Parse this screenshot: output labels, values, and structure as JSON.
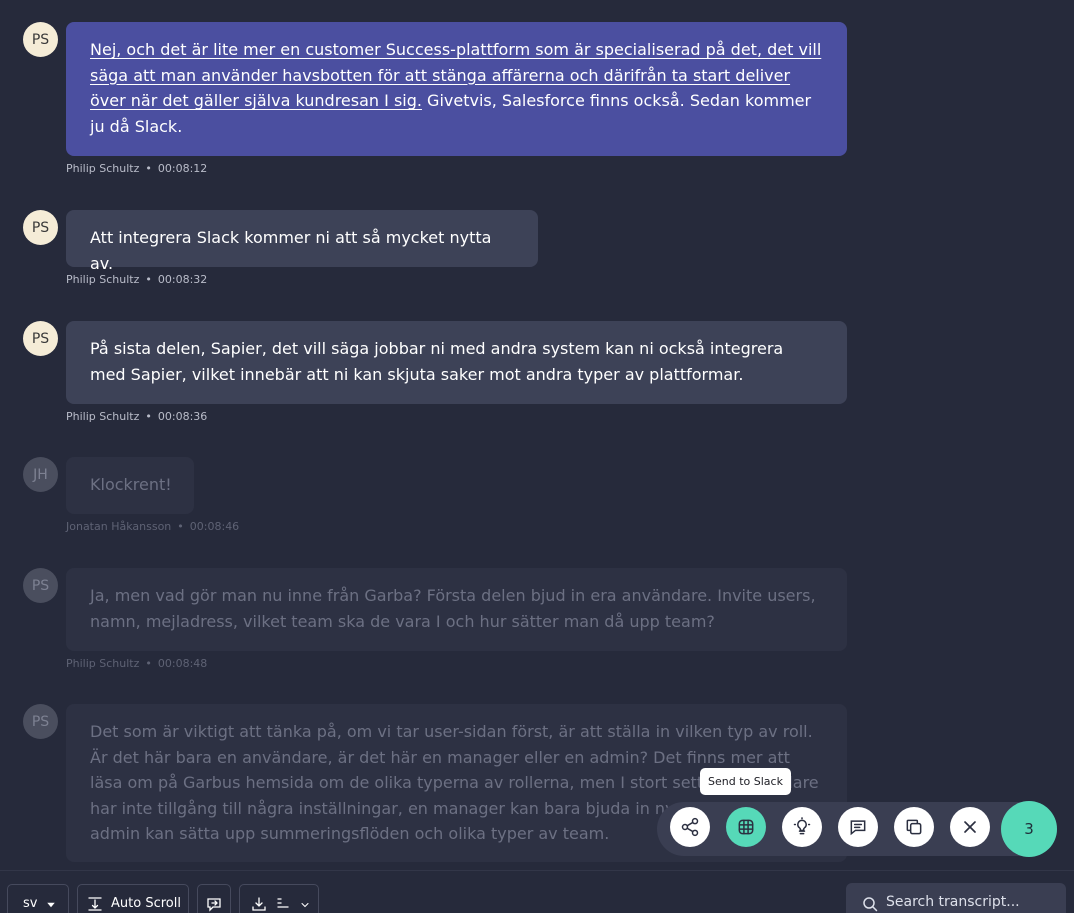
{
  "messages": [
    {
      "initials": "PS",
      "text_highlight": "Nej, och det är lite mer en customer Success-plattform som är specialiserad på det, det vill säga att man använder havsbotten för att stänga affärerna och därifrån ta start deliver över när det gäller själva kundresan I sig.",
      "text_rest": " Givetvis, Salesforce finns också. Sedan kommer ju då Slack.",
      "speaker": "Philip Schultz",
      "time": "00:08:12"
    },
    {
      "initials": "PS",
      "text": "Att integrera Slack kommer ni att så mycket nytta av.",
      "speaker": "Philip Schultz",
      "time": "00:08:32"
    },
    {
      "initials": "PS",
      "text": "På sista delen, Sapier, det vill säga jobbar ni med andra system kan ni också integrera med Sapier, vilket innebär att ni kan skjuta saker mot andra typer av plattformar.",
      "speaker": "Philip Schultz",
      "time": "00:08:36"
    },
    {
      "initials": "JH",
      "text": "Klockrent!",
      "speaker": "Jonatan Håkansson",
      "time": "00:08:46"
    },
    {
      "initials": "PS",
      "text": "Ja, men vad gör man nu inne från Garba? Första delen bjud in era användare. Invite users, namn, mejladress, vilket team ska de vara I och hur sätter man då upp team?",
      "speaker": "Philip Schultz",
      "time": "00:08:48"
    },
    {
      "initials": "PS",
      "text": "Det som är viktigt att tänka på, om vi tar user-sidan först, är att ställa in vilken typ av roll. Är det här bara en användare, är det här en manager eller en admin? Det finns mer att läsa om på Garbus hemsida om de olika typerna av rollerna, men I stort sett en användare har inte tillgång till några inställningar, en manager kan bara bjuda in nya personer och en admin kan sätta upp summeringsflöden och olika typer av team.",
      "speaker": "",
      "time": ""
    }
  ],
  "toolbar": {
    "tooltip": "Send to Slack",
    "selected_count": "3",
    "icons": [
      "share-icon",
      "slack-icon",
      "lightbulb-icon",
      "comment-icon",
      "copy-icon",
      "close-icon"
    ]
  },
  "bottom": {
    "language": "sv",
    "auto_scroll": "Auto Scroll",
    "search_placeholder": "Search transcript..."
  },
  "colors": {
    "background": "#262a3b",
    "bubble": "#3d4257",
    "bubble_active": "#4b4fa0",
    "accent": "#56d9b8"
  }
}
